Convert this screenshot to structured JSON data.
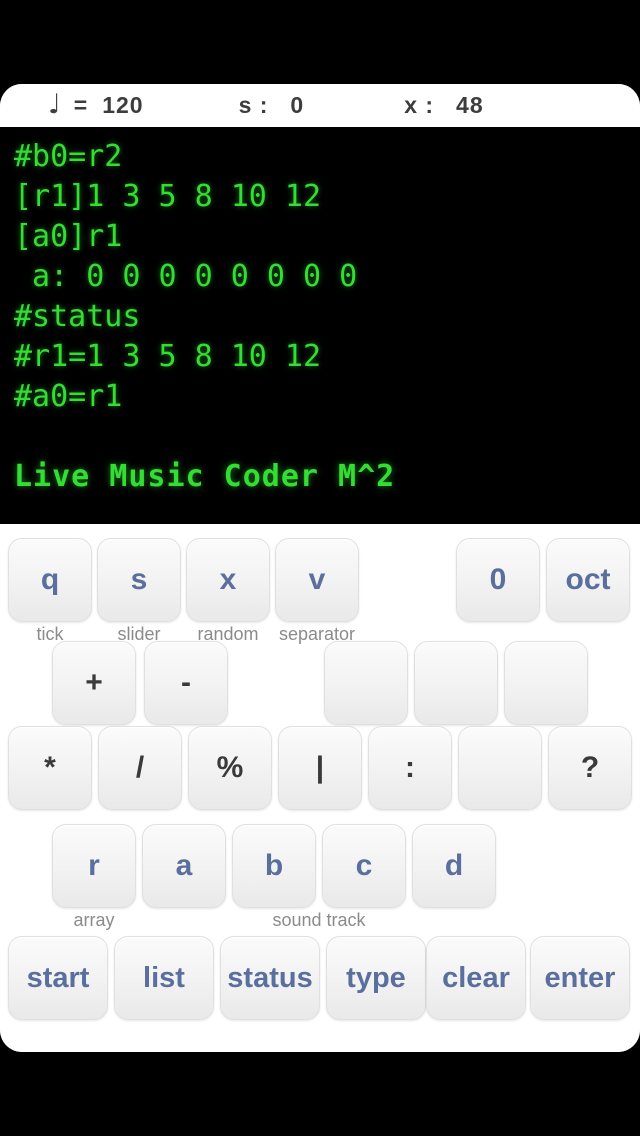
{
  "status_bar": {
    "note_icon": "quarter-note-icon",
    "tempo_label": "=",
    "tempo_value": "120",
    "slider_label": "s :",
    "slider_value": "0",
    "x_label": "x :",
    "x_value": "48"
  },
  "terminal": {
    "lines": [
      "#b0=r2",
      "[r1]1 3 5 8 10 12",
      "[a0]r1",
      " a: 0 0 0 0 0 0 0 0",
      "#status",
      "#r1=1 3 5 8 10 12",
      "#a0=r1"
    ],
    "title": "Live Music Coder M^2",
    "text_color": "#33dd33",
    "background_color": "#000000"
  },
  "keyboard": {
    "key_text_color": "#5a6f9e",
    "symbol_text_color": "#3a3a3a",
    "sublabel_color": "#8b8b8b",
    "rows": [
      {
        "name": "row-1",
        "keys": [
          {
            "label": "q",
            "sub": "tick"
          },
          {
            "label": "s",
            "sub": "slider"
          },
          {
            "label": "x",
            "sub": "random"
          },
          {
            "label": "v",
            "sub": "separator"
          },
          {
            "label": "0",
            "sub": ""
          },
          {
            "label": "oct",
            "sub": ""
          }
        ]
      },
      {
        "name": "row-2",
        "keys": [
          {
            "label": "+",
            "sub": ""
          },
          {
            "label": "-",
            "sub": ""
          },
          {
            "label": "",
            "sub": ""
          },
          {
            "label": "",
            "sub": ""
          },
          {
            "label": "",
            "sub": ""
          }
        ]
      },
      {
        "name": "row-3",
        "keys": [
          {
            "label": "*",
            "sub": ""
          },
          {
            "label": "/",
            "sub": ""
          },
          {
            "label": "%",
            "sub": ""
          },
          {
            "label": "|",
            "sub": ""
          },
          {
            "label": ":",
            "sub": ""
          },
          {
            "label": "",
            "sub": ""
          },
          {
            "label": "?",
            "sub": ""
          }
        ]
      },
      {
        "name": "row-4",
        "keys": [
          {
            "label": "r",
            "sub": "array"
          },
          {
            "label": "a",
            "sub": ""
          },
          {
            "label": "b",
            "sub": "sound track"
          },
          {
            "label": "c",
            "sub": ""
          },
          {
            "label": "d",
            "sub": ""
          }
        ]
      },
      {
        "name": "row-5",
        "keys": [
          {
            "label": "start",
            "sub": ""
          },
          {
            "label": "list",
            "sub": ""
          },
          {
            "label": "status",
            "sub": ""
          },
          {
            "label": "type",
            "sub": ""
          },
          {
            "label": "clear",
            "sub": ""
          },
          {
            "label": "enter",
            "sub": ""
          }
        ]
      }
    ]
  }
}
